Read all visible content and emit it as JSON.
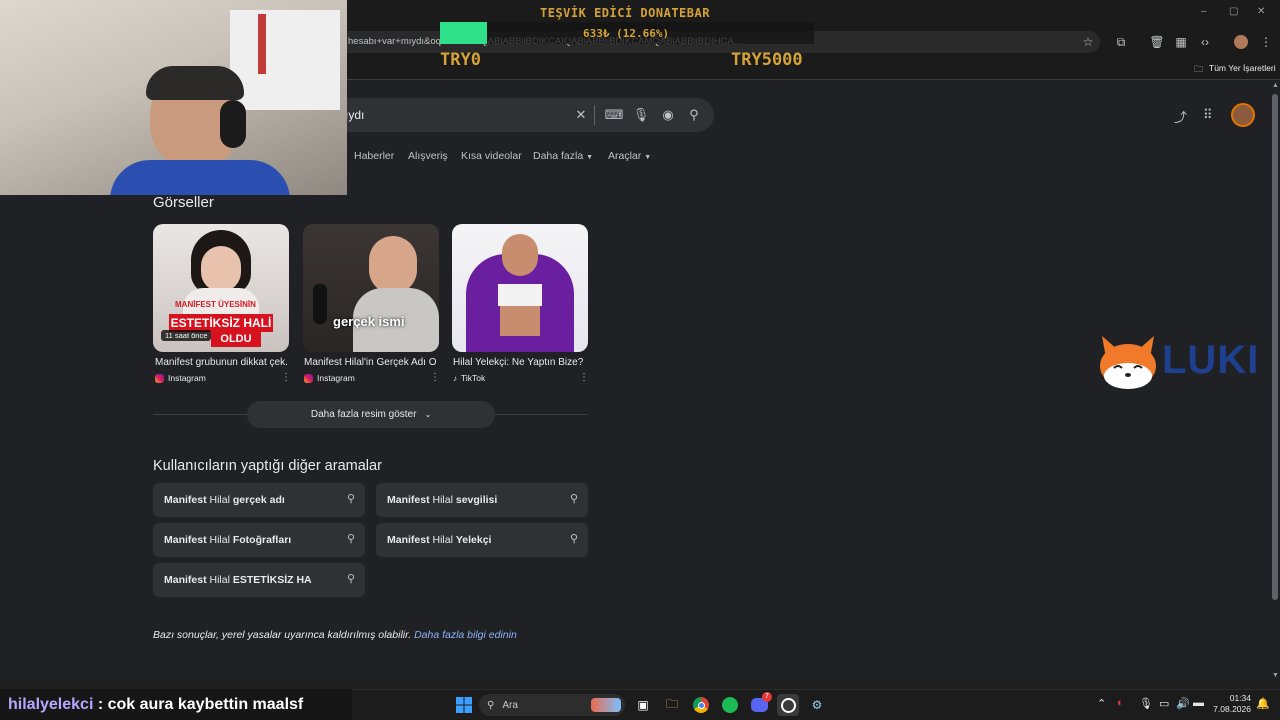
{
  "browser": {
    "url_text": "hesabı+var+mıydı&oq=...KCAEQABiABBiiBDIKCAIQABiABBiiBDIKCAMQABiABBiiBDIHCA...",
    "bookmarks_label": "Tüm Yer İşaretleri",
    "window_controls": {
      "minimize": "–",
      "maximize": "▢",
      "close": "✕"
    }
  },
  "search": {
    "query": "ıydı",
    "nav_tabs": [
      "Haberler",
      "Alışveriş",
      "Kısa videolar",
      "Daha fazla",
      "Araçlar"
    ]
  },
  "images_section": {
    "title": "Görseller",
    "items": [
      {
        "caption": "Manifest grubunun dikkat çek...",
        "source": "Instagram",
        "overlay_top": "MANİFEST ÜYESİNİN",
        "overlay_main": "ESTETİKSİZ HALİ",
        "overlay_sub": "OLDU",
        "badge": "11 saat önce"
      },
      {
        "caption": "Manifest Hilal'in Gerçek Adı O...",
        "source": "Instagram",
        "overlay_main": "gerçek ismi"
      },
      {
        "caption": "Hilal Yelekçi: Ne Yaptın Bize?",
        "source": "TikTok"
      }
    ],
    "more_button": "Daha fazla resim göster"
  },
  "related": {
    "title": "Kullanıcıların yaptığı diğer aramalar",
    "chips": [
      {
        "bold1": "Manifest",
        "thin": " Hilal ",
        "bold2": "gerçek adı"
      },
      {
        "bold1": "Manifest",
        "thin": " Hilal ",
        "bold2": "sevgilisi"
      },
      {
        "bold1": "Manifest",
        "thin": " Hilal ",
        "bold2": "Fotoğrafları"
      },
      {
        "bold1": "Manifest",
        "thin": " Hilal ",
        "bold2": "Yelekçi"
      },
      {
        "bold1": "Manifest",
        "thin": " Hilal ",
        "bold2": "ESTETİKSİZ HA"
      }
    ]
  },
  "disclaimer": {
    "text": "Bazı sonuçlar, yerel yasalar uyarınca kaldırılmış olabilir. ",
    "link": "Daha fazla bilgi edinin"
  },
  "overlay": {
    "donate_title": "TEŞVİK EDİCİ DONATEBAR",
    "donate_value": "633₺ (12.66%)",
    "donate_progress_fraction": 0.1266,
    "donate_min": "TRY0",
    "donate_max": "TRY5000",
    "brand_text": "LUKI"
  },
  "chat": {
    "user": "hilalyelekci",
    "message": " : cok aura kaybettin maalsf"
  },
  "taskbar": {
    "search_placeholder": "Ara",
    "discord_badge": "7",
    "time": "01:34",
    "date": "7.08.2026"
  }
}
